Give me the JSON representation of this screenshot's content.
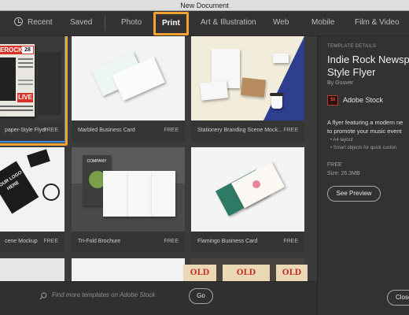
{
  "window": {
    "title": "New Document"
  },
  "tabs": [
    {
      "label": "Recent"
    },
    {
      "label": "Saved"
    },
    {
      "label": "Photo"
    },
    {
      "label": "Print"
    },
    {
      "label": "Art & Illustration"
    },
    {
      "label": "Web"
    },
    {
      "label": "Mobile"
    },
    {
      "label": "Film & Video"
    }
  ],
  "templates": [
    {
      "name": "Indie Rock Newspaper-Style Flyer",
      "visible_name": "paper-Style Flyer",
      "badge": "FREE",
      "art": {
        "head": "EROCK",
        "num": "28",
        "word": "LIVE"
      }
    },
    {
      "name": "Marbled Business Card",
      "badge": "FREE"
    },
    {
      "name": "Stationery Branding Scene Mock...",
      "badge": "FREE"
    },
    {
      "name": "cene Mockup",
      "badge": "FREE",
      "art": {
        "text": "YOUR LOGO HERE"
      }
    },
    {
      "name": "Tri-Fold Brochure",
      "badge": "FREE",
      "art": {
        "text": "COMPANY"
      }
    },
    {
      "name": "Flamingo Business Card",
      "badge": "FREE"
    }
  ],
  "bottom_thumbs": {
    "text": "OLD MUSIC"
  },
  "search": {
    "placeholder": "Find more templates on Adobe Stock",
    "go_label": "Go"
  },
  "details": {
    "section_label": "TEMPLATE DETAILS",
    "title_line1": "Indie Rock Newsp",
    "title_line2": "Style Flyer",
    "by": "By Guuver",
    "provider_logo": "St",
    "provider": "Adobe Stock",
    "desc_line1": "A flyer featuring a modern ne",
    "desc_line2": "to promote your music event",
    "bullets": [
      "• A4 layout",
      "• Smart objects for quick custon"
    ],
    "price": "FREE",
    "size": "Size: 26.3MB",
    "preview_label": "See Preview",
    "close_label": "Close"
  },
  "colors": {
    "accent_highlight": "#f3a231",
    "selection_blue": "#3b8ee0",
    "stock_red": "#ec5a46"
  }
}
